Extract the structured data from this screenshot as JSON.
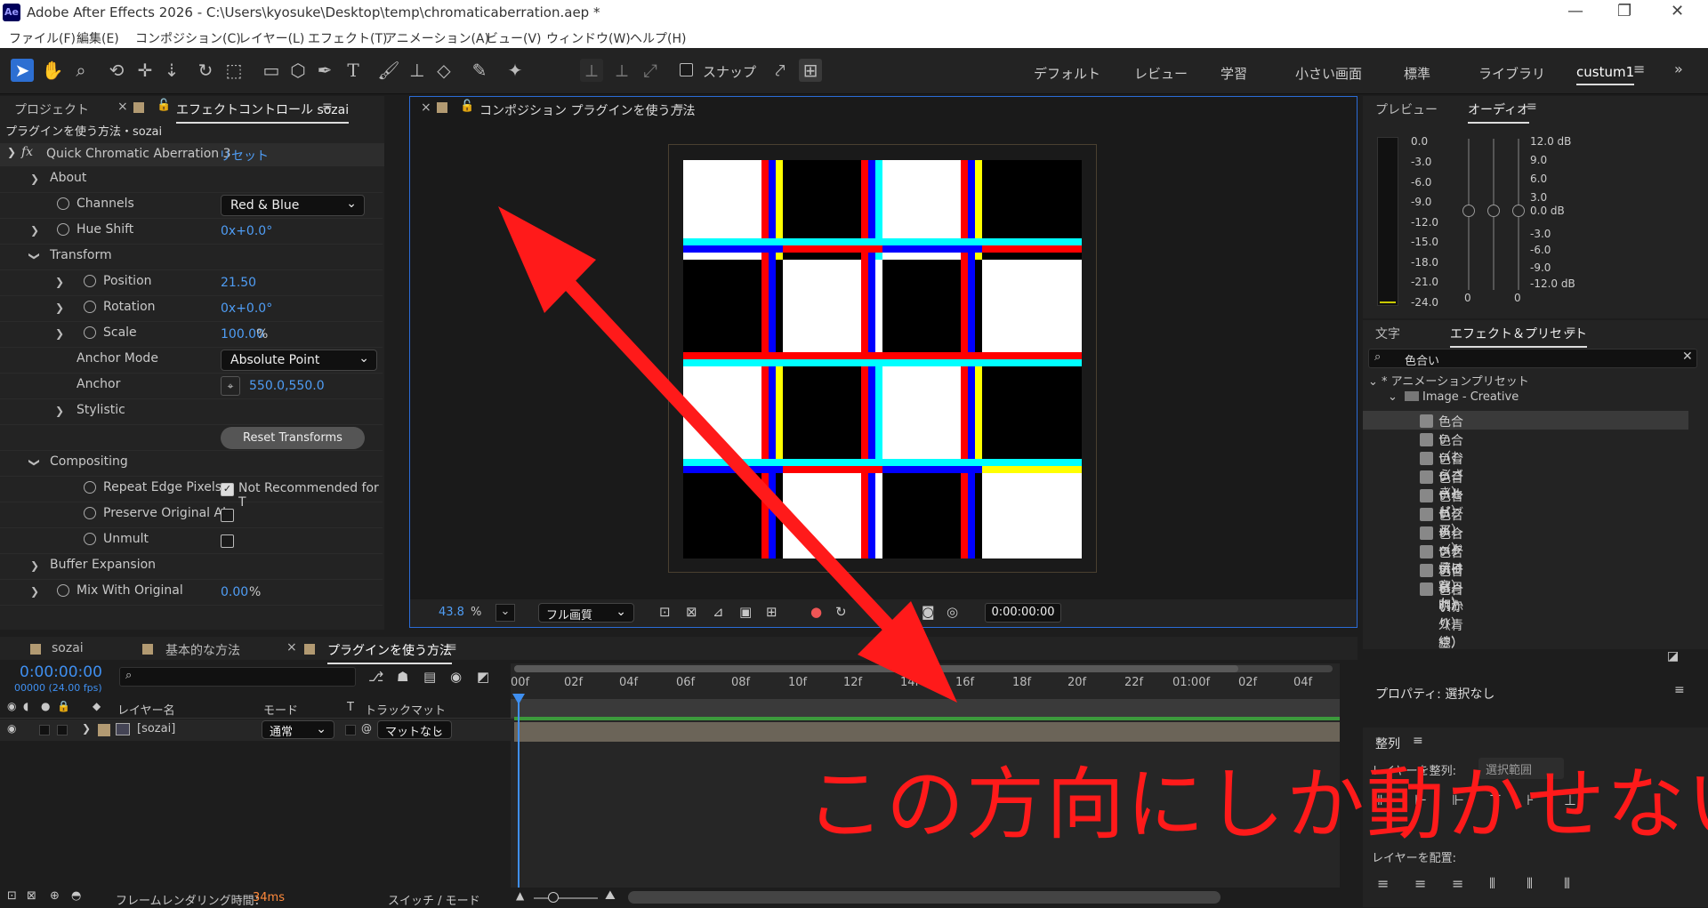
{
  "window": {
    "title": "Adobe After Effects 2026 - C:\\Users\\kyosuke\\Desktop\\temp\\chromaticaberration.aep *",
    "logo": "Ae"
  },
  "menu": [
    "ファイル(F)",
    "編集(E)",
    "コンポジション(C)",
    "レイヤー(L)",
    "エフェクト(T)",
    "アニメーション(A)",
    "ビュー(V)",
    "ウィンドウ(W)",
    "ヘルプ(H)"
  ],
  "toolbar": {
    "snap_label": "スナップ",
    "workspaces": [
      "デフォルト",
      "レビュー",
      "学習",
      "小さい画面",
      "標準",
      "ライブラリ",
      "custum1"
    ]
  },
  "effect_panel": {
    "tabs": [
      "プロジェクト",
      "エフェクトコントロール sozai"
    ],
    "breadcrumb": "プラグインを使う方法・sozai",
    "effect_name": "Quick Chromatic Aberration 3",
    "reset": "リセット",
    "rows": {
      "about": "About",
      "channels": "Channels",
      "channels_value": "Red & Blue",
      "hue_shift": "Hue Shift",
      "hue_shift_value": "0x+0.0°",
      "transform": "Transform",
      "position": "Position",
      "position_value": "21.50",
      "rotation": "Rotation",
      "rotation_value": "0x+0.0°",
      "scale": "Scale",
      "scale_value": "100.00",
      "scale_unit": "%",
      "anchor_mode": "Anchor Mode",
      "anchor_mode_value": "Absolute Point",
      "anchor": "Anchor",
      "anchor_value": "550.0,550.0",
      "stylistic": "Stylistic",
      "reset_transforms": "Reset Transforms",
      "compositing": "Compositing",
      "repeat_edge": "Repeat Edge Pixels",
      "repeat_edge_note": "Not Recommended for T",
      "preserve": "Preserve Original Al",
      "unmult": "Unmult",
      "buffer": "Buffer Expansion",
      "mix": "Mix With Original",
      "mix_value": "0.00",
      "mix_unit": "%"
    }
  },
  "comp": {
    "tab": "コンポジション プラグインを使う方法",
    "zoom": "43.8",
    "zoom_unit": "%",
    "quality": "フル画質",
    "timecode": "0:00:00:00"
  },
  "right": {
    "preview_tabs": [
      "プレビュー",
      "オーディオ"
    ],
    "meter_left": [
      "0.0",
      "-3.0",
      "-6.0",
      "-9.0",
      "-12.0",
      "-15.0",
      "-18.0",
      "-21.0",
      "-24.0"
    ],
    "meter_right": [
      "12.0 dB",
      "9.0",
      "6.0",
      "3.0",
      "0.0 dB",
      "-3.0",
      "-6.0",
      "-9.0",
      "-12.0 dB"
    ],
    "meter_zeros": [
      "0",
      "0"
    ],
    "fx_tabs": [
      "文字",
      "エフェクト＆プリセット"
    ],
    "search": "色合い",
    "tree_root": "* アニメーションプリセット",
    "tree_folder": "Image - Creative",
    "items": [
      "色合い（むらさき）",
      "色合い（ゴールド）",
      "色合い（セピア）",
      "色合い（ブルー）",
      "色合い（レッドティント）",
      "色合い（夕焼け空）",
      "色合い（日暮れ）",
      "色合い（月明かり）",
      "色合い（赤外線）",
      "色合い（青空）"
    ],
    "properties": "プロパティ: 選択なし",
    "align_title": "整列",
    "align_layer": "レイヤーを整列:",
    "align_range": "選択範囲",
    "distribute": "レイヤーを配置:"
  },
  "timeline": {
    "tabs": [
      "sozai",
      "基本的な方法",
      "プラグインを使う方法"
    ],
    "timecode": "0:00:00:00",
    "fps": "00000 (24.00 fps)",
    "ruler": [
      "00f",
      "02f",
      "04f",
      "06f",
      "08f",
      "10f",
      "12f",
      "14f",
      "16f",
      "18f",
      "20f",
      "22f",
      "01:00f",
      "02f",
      "04f"
    ],
    "headers": {
      "layer_name": "レイヤー名",
      "mode": "モード",
      "t": "T",
      "track_matte": "トラックマット"
    },
    "layer": {
      "name": "[sozai]",
      "mode": "通常",
      "matte": "マットなし"
    },
    "status": {
      "render_label": "フレームレンダリング時間：",
      "render_value": "34ms",
      "switch": "スイッチ / モード"
    }
  },
  "annotation": {
    "text": "この方向にしか動かせない",
    "color": "#ff1a1a"
  }
}
